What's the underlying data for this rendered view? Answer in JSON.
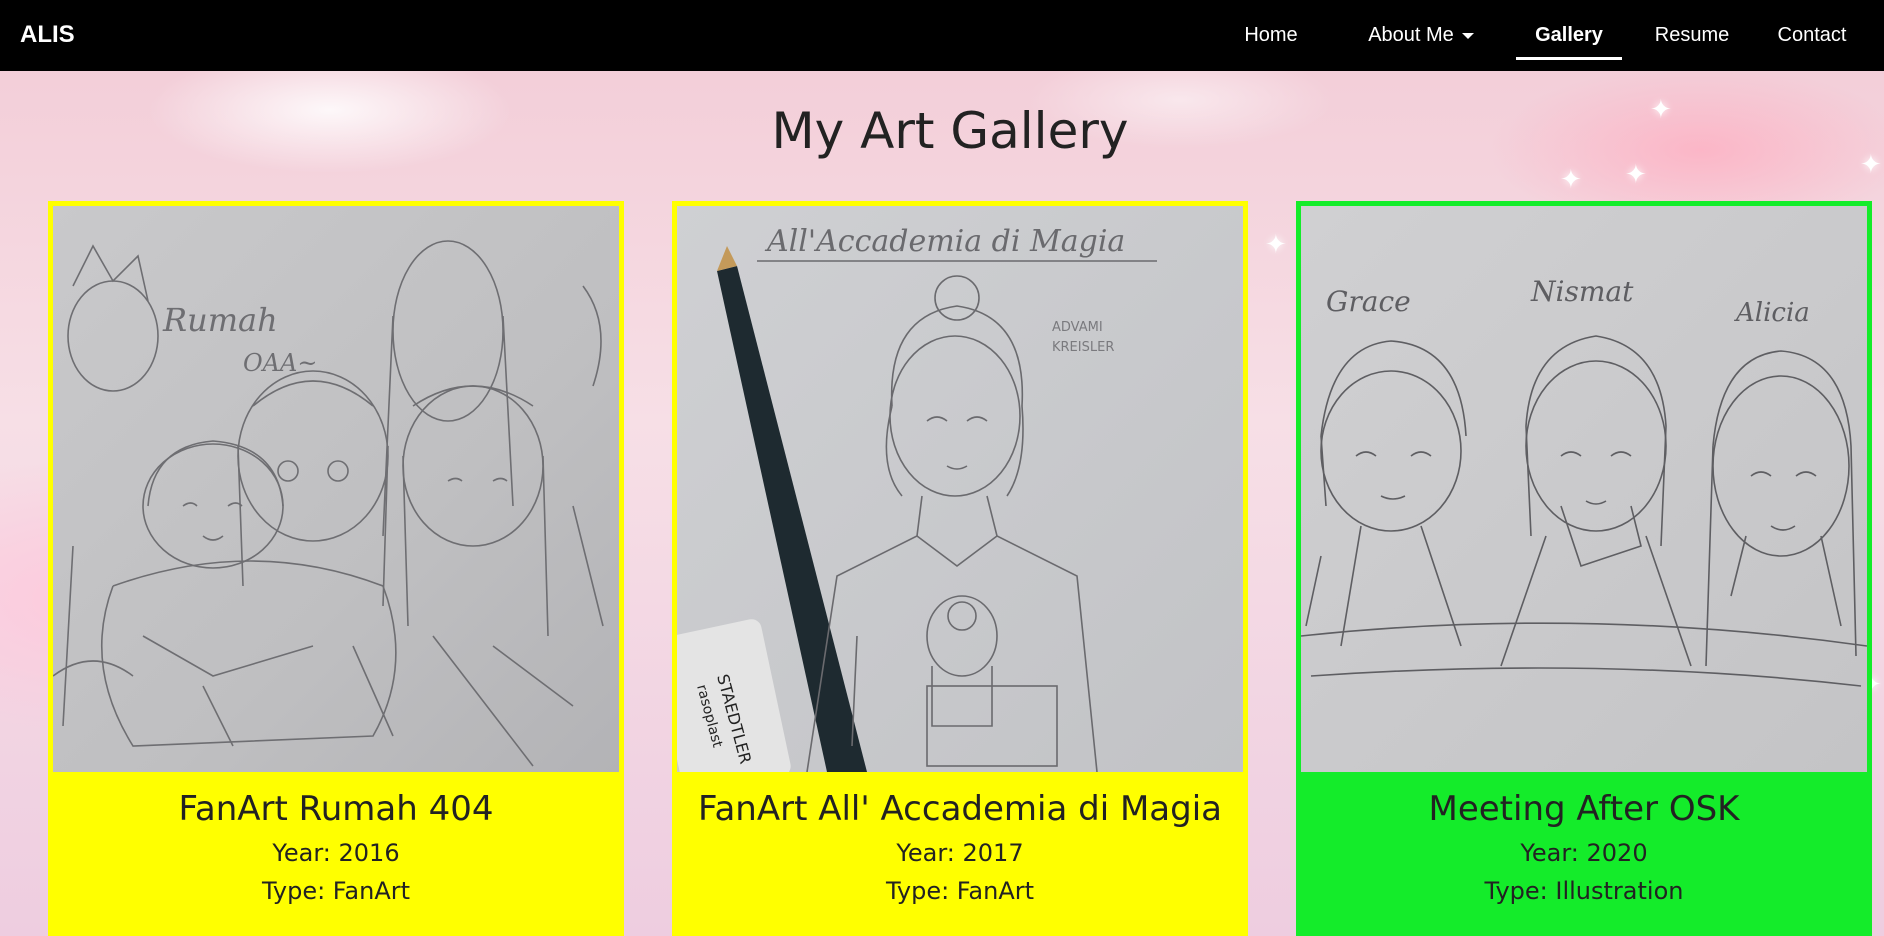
{
  "nav": {
    "brand": "ALIS",
    "items": [
      {
        "label": "Home",
        "active": false
      },
      {
        "label": "About Me",
        "active": false,
        "dropdown": true
      },
      {
        "label": "Gallery",
        "active": true
      },
      {
        "label": "Resume",
        "active": false
      },
      {
        "label": "Contact",
        "active": false
      }
    ]
  },
  "page": {
    "title": "My Art Gallery"
  },
  "gallery": [
    {
      "title": "FanArt Rumah 404",
      "year": "Year: 2016",
      "type": "Type: FanArt",
      "color": "#ffff00",
      "sketch_text": [
        "Rumah",
        "OAA~"
      ]
    },
    {
      "title": "FanArt All' Accademia di Magia",
      "year": "Year: 2017",
      "type": "Type: FanArt",
      "color": "#ffff00",
      "sketch_text": [
        "All'Accademia di Magia",
        "ADVAMI",
        "KREISLER",
        "STAEDTLER",
        "rasoplast"
      ]
    },
    {
      "title": "Meeting After OSK",
      "year": "Year: 2020",
      "type": "Type: Illustration",
      "color": "#14ec2a",
      "sketch_text": [
        "Grace",
        "Nismat",
        "Alicia"
      ]
    }
  ],
  "colors": {
    "nav_bg": "#000000",
    "card_yellow": "#ffff00",
    "card_green": "#14ec2a"
  }
}
